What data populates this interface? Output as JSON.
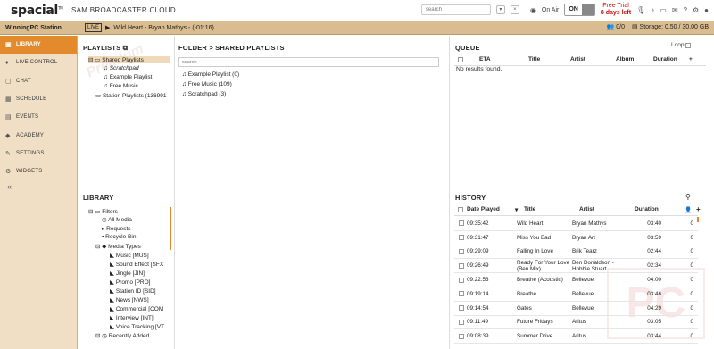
{
  "app": {
    "logo": "spacial",
    "logo_tm": "TM",
    "title": "SAM BROADCASTER CLOUD",
    "search_placeholder": "search",
    "onair_label": "On Air",
    "onair_state": "ON",
    "trial_line1": "Free Trial",
    "trial_line2": "8 days left"
  },
  "nowplaying": {
    "station": "WinningPC Station",
    "live": "LIVE",
    "track": "Wild Heart - Bryan Mathys - (-01:16)",
    "listeners": "0/0",
    "storage": "Storage: 0.50 / 30.00 GB"
  },
  "sidebar": {
    "items": [
      {
        "label": "LIBRARY",
        "icon": "library-icon"
      },
      {
        "label": "LIVE CONTROL",
        "icon": "microphone-icon"
      },
      {
        "label": "CHAT",
        "icon": "chat-icon"
      },
      {
        "label": "SCHEDULE",
        "icon": "calendar-icon"
      },
      {
        "label": "EVENTS",
        "icon": "events-icon"
      },
      {
        "label": "ACADEMY",
        "icon": "academy-icon"
      },
      {
        "label": "SETTINGS",
        "icon": "wrench-icon"
      },
      {
        "label": "WIDGETS",
        "icon": "gears-icon"
      }
    ],
    "collapse": "«"
  },
  "playlists": {
    "title": "PLAYLISTS",
    "items": [
      "Shared Playlists",
      "Scratchpad",
      "Example Playlist",
      "Free Music",
      "Station Playlists (136991"
    ]
  },
  "folder": {
    "title": "FOLDER > SHARED PLAYLISTS",
    "search_placeholder": "search",
    "items": [
      "Example Playlist (0)",
      "Free Music (109)",
      "Scratchpad (3)"
    ]
  },
  "queue": {
    "title": "QUEUE",
    "loop_label": "Loop",
    "columns": [
      "ETA",
      "Title",
      "Artist",
      "Album",
      "Duration"
    ],
    "empty": "No results found."
  },
  "library": {
    "title": "LIBRARY",
    "items": [
      "Filters",
      "All Media",
      "Requests",
      "Recycle Bin",
      "Media Types",
      "Music [MUS]",
      "Sound Effect [SFX",
      "Jingle [JIN]",
      "Promo [PRO]",
      "Station ID [SID]",
      "News [NWS]",
      "Commercial [COM",
      "Interview [INT]",
      "Voice Tracking [VT",
      "Recently Added"
    ]
  },
  "history": {
    "title": "HISTORY",
    "columns": [
      "Date Played",
      "Title",
      "Artist",
      "Duration"
    ],
    "rows": [
      {
        "time": "09:35:42",
        "title": "Wild Heart",
        "artist": "Bryan Mathys",
        "duration": "03:40",
        "count": "0"
      },
      {
        "time": "09:31:47",
        "title": "Miss You Bad",
        "artist": "Bryan Art",
        "duration": "03:59",
        "count": "0"
      },
      {
        "time": "09:29:09",
        "title": "Falling In Love",
        "artist": "Brik Tearz",
        "duration": "02:44",
        "count": "0"
      },
      {
        "time": "09:26:49",
        "title": "Ready For Your Love (Ben Mix)",
        "artist": "Ben Donaldson - Hobbie Stuart",
        "duration": "02:34",
        "count": "0"
      },
      {
        "time": "09:22:53",
        "title": "Breathe (Acoustic)",
        "artist": "Bellevue",
        "duration": "04:00",
        "count": "0"
      },
      {
        "time": "09:19:14",
        "title": "Breathe",
        "artist": "Bellevue",
        "duration": "03:46",
        "count": "0"
      },
      {
        "time": "09:14:54",
        "title": "Gates",
        "artist": "Bellevue",
        "duration": "04:29",
        "count": "0"
      },
      {
        "time": "09:11:49",
        "title": "Future Fridays",
        "artist": "Aritus",
        "duration": "03:05",
        "count": "0"
      },
      {
        "time": "09:08:39",
        "title": "Summer Drive",
        "artist": "Aritus",
        "duration": "03:44",
        "count": "0"
      }
    ]
  },
  "colors": {
    "accent": "#e38a2d",
    "sidebar": "#f0dfc4",
    "bar": "#d9bc8f",
    "trial": "#cc1111"
  }
}
